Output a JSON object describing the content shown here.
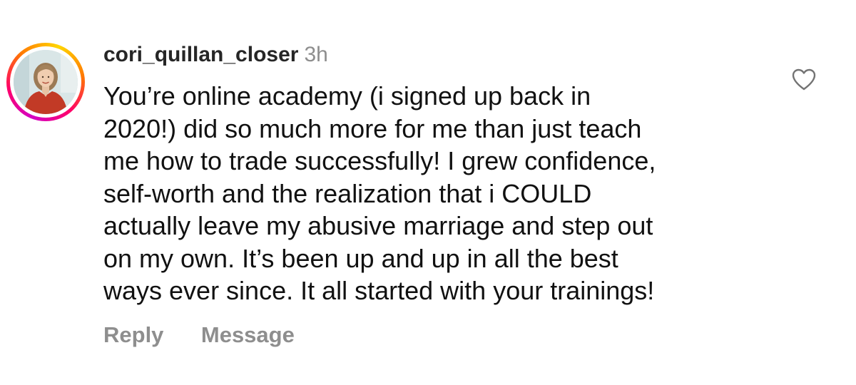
{
  "comment": {
    "username": "cori_quillan_closer",
    "time": "3h",
    "lines": [
      "You’re online academy (i signed up back in",
      "2020!) did so much more for me than just teach",
      "me how to trade successfully! I grew confidence,",
      "self-worth and the realization that i COULD",
      "actually leave my abusive marriage and step out",
      "on my own. It’s been up and up in all the best",
      "ways ever since. It all started with your trainings!"
    ],
    "actions": {
      "reply": "Reply",
      "message": "Message"
    },
    "icons": {
      "like": "heart-icon",
      "avatar": "profile-photo"
    },
    "colors": {
      "username": "#262626",
      "secondary": "#8e8e8e",
      "story_ring": [
        "#d300c5",
        "#ff0069",
        "#ff7a00",
        "#ffd600"
      ]
    }
  }
}
